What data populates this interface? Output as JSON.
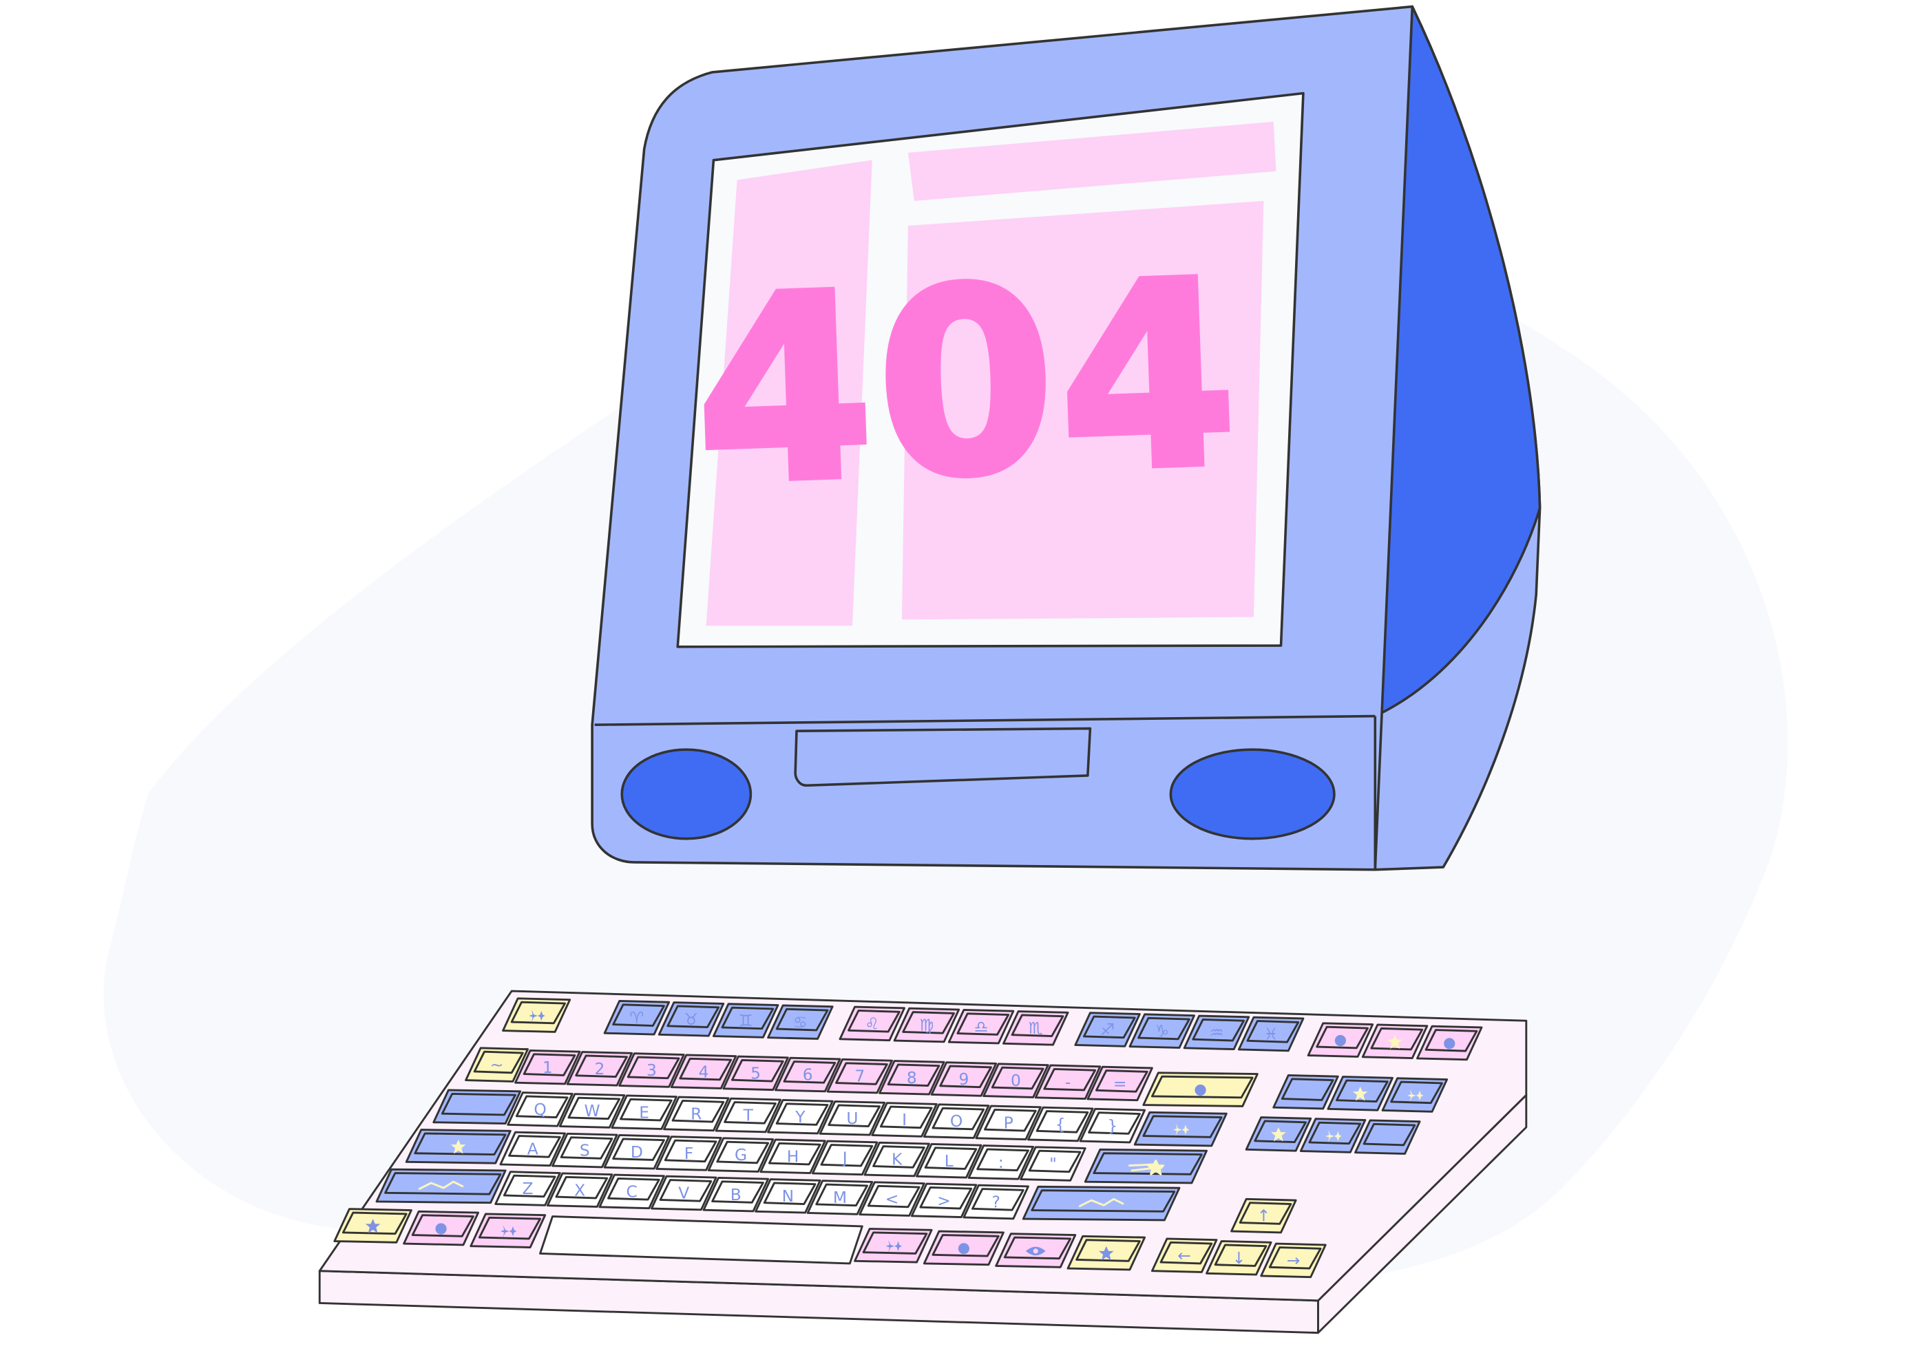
{
  "screen": {
    "error_code": "404"
  },
  "keyboard": {
    "function_row": [
      {
        "label": "♈"
      },
      {
        "label": "♉"
      },
      {
        "label": "♊"
      },
      {
        "label": "♋"
      },
      {
        "label": "♌"
      },
      {
        "label": "♍"
      },
      {
        "label": "♎"
      },
      {
        "label": "♏"
      },
      {
        "label": "♐"
      },
      {
        "label": "♑"
      },
      {
        "label": "♒"
      },
      {
        "label": "♓"
      }
    ],
    "number_row": [
      "1",
      "2",
      "3",
      "4",
      "5",
      "6",
      "7",
      "8",
      "9",
      "0",
      "-",
      "="
    ],
    "top_row": [
      "Q",
      "W",
      "E",
      "R",
      "T",
      "Y",
      "U",
      "I",
      "O",
      "P",
      "{",
      "}"
    ],
    "home_row": [
      "A",
      "S",
      "D",
      "F",
      "G",
      "H",
      "J",
      "K",
      "L",
      ":",
      "\""
    ],
    "bottom_row": [
      "Z",
      "X",
      "C",
      "V",
      "B",
      "N",
      "M",
      "<",
      ">",
      "?"
    ],
    "arrows": {
      "up": "↑",
      "left": "←",
      "down": "↓",
      "right": "→"
    }
  },
  "colors": {
    "monitor_body": "#a3b8fc",
    "monitor_side": "#3f6cf3",
    "screen_bezel": "#f8fafc",
    "screen_panel": "#fed1f7",
    "error_text": "#ff7bdb",
    "outline": "#333333",
    "key_blue": "#a3b8fc",
    "key_pink": "#fed1f7",
    "key_yellow": "#fdf6bd",
    "key_white": "#ffffff",
    "keyboard_base": "#fdf1fb",
    "backdrop": "#f8f9fd"
  },
  "icons": [
    "star-icon",
    "moon-icon",
    "sparkles-icon",
    "planet-icon",
    "eye-icon",
    "constellation-icon",
    "shooting-star-icon"
  ]
}
